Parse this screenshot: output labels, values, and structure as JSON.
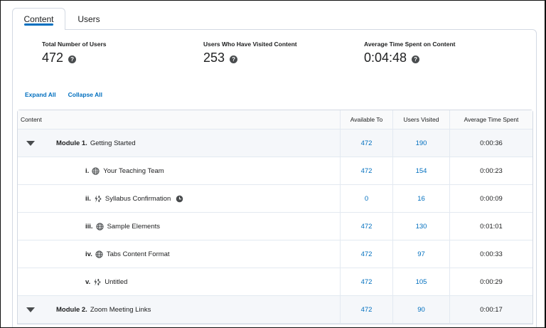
{
  "tabs": [
    {
      "label": "Content",
      "active": true
    },
    {
      "label": "Users",
      "active": false
    }
  ],
  "stats": [
    {
      "label": "Total Number of Users",
      "value": "472"
    },
    {
      "label": "Users Who Have Visited Content",
      "value": "253"
    },
    {
      "label": "Average Time Spent on Content",
      "value": "0:04:48"
    }
  ],
  "actions": {
    "expand_all": "Expand All",
    "collapse_all": "Collapse All"
  },
  "table": {
    "headers": {
      "content": "Content",
      "available": "Available To",
      "visited": "Users Visited",
      "time": "Average Time Spent"
    },
    "rows": [
      {
        "type": "module",
        "num": "Module 1.",
        "title": "Getting Started",
        "available": "472",
        "visited": "190",
        "time": "0:00:36"
      },
      {
        "type": "item",
        "num": "i.",
        "icon": "globe-icon",
        "title": "Your Teaching Team",
        "available": "472",
        "visited": "154",
        "time": "0:00:23"
      },
      {
        "type": "item",
        "num": "ii.",
        "icon": "plugin-icon",
        "title": "Syllabus Confirmation",
        "available": "0",
        "visited": "16",
        "time": "0:00:09",
        "clock": true
      },
      {
        "type": "item",
        "num": "iii.",
        "icon": "globe-icon",
        "title": "Sample Elements",
        "available": "472",
        "visited": "130",
        "time": "0:01:01"
      },
      {
        "type": "item",
        "num": "iv.",
        "icon": "globe-icon",
        "title": "Tabs Content Format",
        "available": "472",
        "visited": "97",
        "time": "0:00:33"
      },
      {
        "type": "item",
        "num": "v.",
        "icon": "plugin-icon",
        "title": "Untitled",
        "available": "472",
        "visited": "105",
        "time": "0:00:29"
      },
      {
        "type": "module",
        "num": "Module 2.",
        "title": "Zoom Meeting Links",
        "available": "472",
        "visited": "90",
        "time": "0:00:17"
      }
    ]
  },
  "colors": {
    "link": "#006fbf",
    "text": "#202122",
    "border": "#d3d9e3",
    "module_bg": "#f5f7fa"
  }
}
